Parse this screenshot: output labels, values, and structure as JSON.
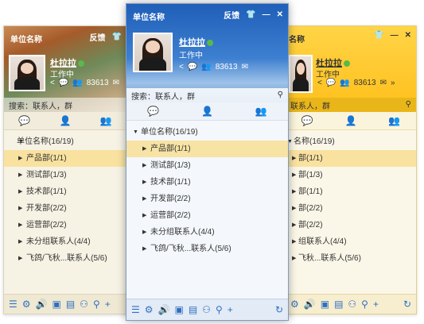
{
  "windows": {
    "left": {
      "title": "单位名称",
      "feedback": "反馈",
      "user": {
        "name": "杜拉拉",
        "status": "工作中",
        "count": "83613"
      },
      "search_placeholder": "搜索：联系人，群",
      "tree": {
        "root": "单位名称(16/19)",
        "items": [
          "产品部(1/1)",
          "测试部(1/3)",
          "技术部(1/1)",
          "开发部(2/2)",
          "运营部(2/2)",
          "未分组联系人(4/4)",
          "飞鸽/飞秋...联系人(5/6)"
        ],
        "selected_index": 0
      }
    },
    "center": {
      "title": "单位名称",
      "feedback": "反馈",
      "user": {
        "name": "杜拉拉",
        "status": "工作中",
        "count": "83613"
      },
      "search_placeholder": "搜索：联系人，群",
      "tree": {
        "root": "单位名称(16/19)",
        "items": [
          "产品部(1/1)",
          "测试部(1/3)",
          "技术部(1/1)",
          "开发部(2/2)",
          "运营部(2/2)",
          "未分组联系人(4/4)",
          "飞鸽/飞秋...联系人(5/6)"
        ],
        "selected_index": 0
      }
    },
    "right": {
      "title": "名称",
      "user": {
        "name": "杜拉拉",
        "status": "工作中",
        "count": "83613"
      },
      "search_placeholder": "联系人，群",
      "tree": {
        "root": "名称(16/19)",
        "items": [
          "部(1/1)",
          "部(1/3)",
          "部(1/1)",
          "部(2/2)",
          "部(2/2)",
          "组联系人(4/4)",
          "飞秋...联系人(5/6)"
        ],
        "selected_index": 0
      }
    }
  },
  "icons": {
    "shirt": "shirt-icon",
    "minimize": "minimize-icon",
    "close": "close-icon",
    "share": "share-icon",
    "chat": "chat-icon",
    "group": "group-icon",
    "mail": "mail-icon",
    "search": "search-icon",
    "menu": "menu-icon",
    "settings": "gear-icon",
    "volume": "volume-icon",
    "image": "image-icon",
    "folder": "folder-icon",
    "add-contact": "add-contact-icon",
    "find": "find-icon",
    "add": "add-icon",
    "refresh": "refresh-icon"
  },
  "colors": {
    "accent": "#2f7bd2",
    "selection": "#f9e2a0",
    "online": "#5ab949"
  }
}
